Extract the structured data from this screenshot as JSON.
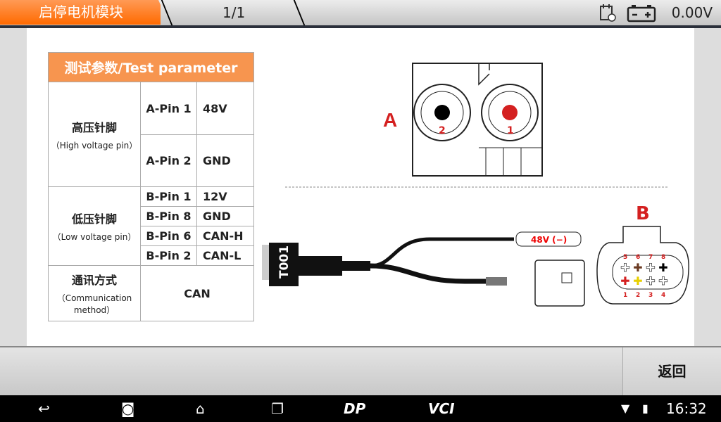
{
  "header": {
    "title": "启停电机模块",
    "page": "1/1",
    "voltage": "0.00V",
    "icons": [
      "calendar-alert-icon",
      "battery-icon"
    ]
  },
  "table": {
    "title": "测试参数/Test parameter",
    "groups": [
      {
        "label": "高压针脚",
        "sub": "（High voltage pin）",
        "rows": [
          {
            "pin": "A-Pin 1",
            "value": "48V"
          },
          {
            "pin": "A-Pin 2",
            "value": "GND"
          }
        ]
      },
      {
        "label": "低压针脚",
        "sub": "（Low voltage pin）",
        "rows": [
          {
            "pin": "B-Pin 1",
            "value": "12V"
          },
          {
            "pin": "B-Pin 8",
            "value": "GND"
          },
          {
            "pin": "B-Pin 6",
            "value": "CAN-H"
          },
          {
            "pin": "B-Pin 2",
            "value": "CAN-L"
          }
        ]
      },
      {
        "label": "通讯方式",
        "sub": "（Communication method）",
        "value": "CAN"
      }
    ]
  },
  "diagram": {
    "connector_a": {
      "label": "A",
      "pins": [
        "2",
        "1"
      ]
    },
    "connector_b": {
      "label": "B",
      "top_pins": [
        "5",
        "6",
        "7",
        "8"
      ],
      "bottom_pins": [
        "1",
        "2",
        "3",
        "4"
      ]
    },
    "cable": {
      "name": "T001",
      "clip_label": "48V (−)"
    }
  },
  "footer": {
    "back": "返回"
  },
  "navbar": {
    "dp": "DP",
    "vci": "VCI",
    "time": "16:32"
  }
}
